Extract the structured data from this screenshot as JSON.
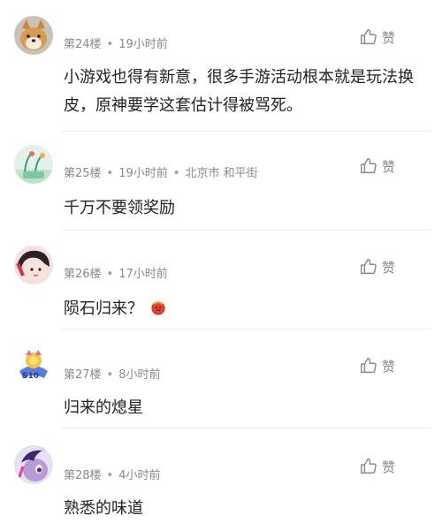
{
  "comments": [
    {
      "floor": "第24楼",
      "time": "19小时前",
      "location": "",
      "like_label": "赞",
      "text": "小游戏也得有新意，很多手游活动根本就是玩法换皮，原神要学这套估计得被骂死。",
      "avatar": "shiba-dog-avatar"
    },
    {
      "floor": "第25楼",
      "time": "19小时前",
      "location": "北京市 和平街",
      "like_label": "赞",
      "text": "千万不要领奖励",
      "avatar": "plant-illustration-avatar"
    },
    {
      "floor": "第26楼",
      "time": "17小时前",
      "location": "",
      "like_label": "赞",
      "text": "陨石归来？",
      "avatar": "anime-character-avatar",
      "emoji": "meteor-emoji"
    },
    {
      "floor": "第27楼",
      "time": "8小时前",
      "location": "",
      "like_label": "赞",
      "text": "归来的熄星",
      "avatar": "s10-badge-avatar"
    },
    {
      "floor": "第28楼",
      "time": "4小时前",
      "location": "",
      "like_label": "赞",
      "text": "熟悉的味道",
      "avatar": "purple-pony-avatar"
    }
  ],
  "colors": {
    "meta_text": "#8a8a8a",
    "body_text": "#222222",
    "divider": "#ececec",
    "meteor_red": "#e0442c"
  },
  "separator_glyph": "•"
}
